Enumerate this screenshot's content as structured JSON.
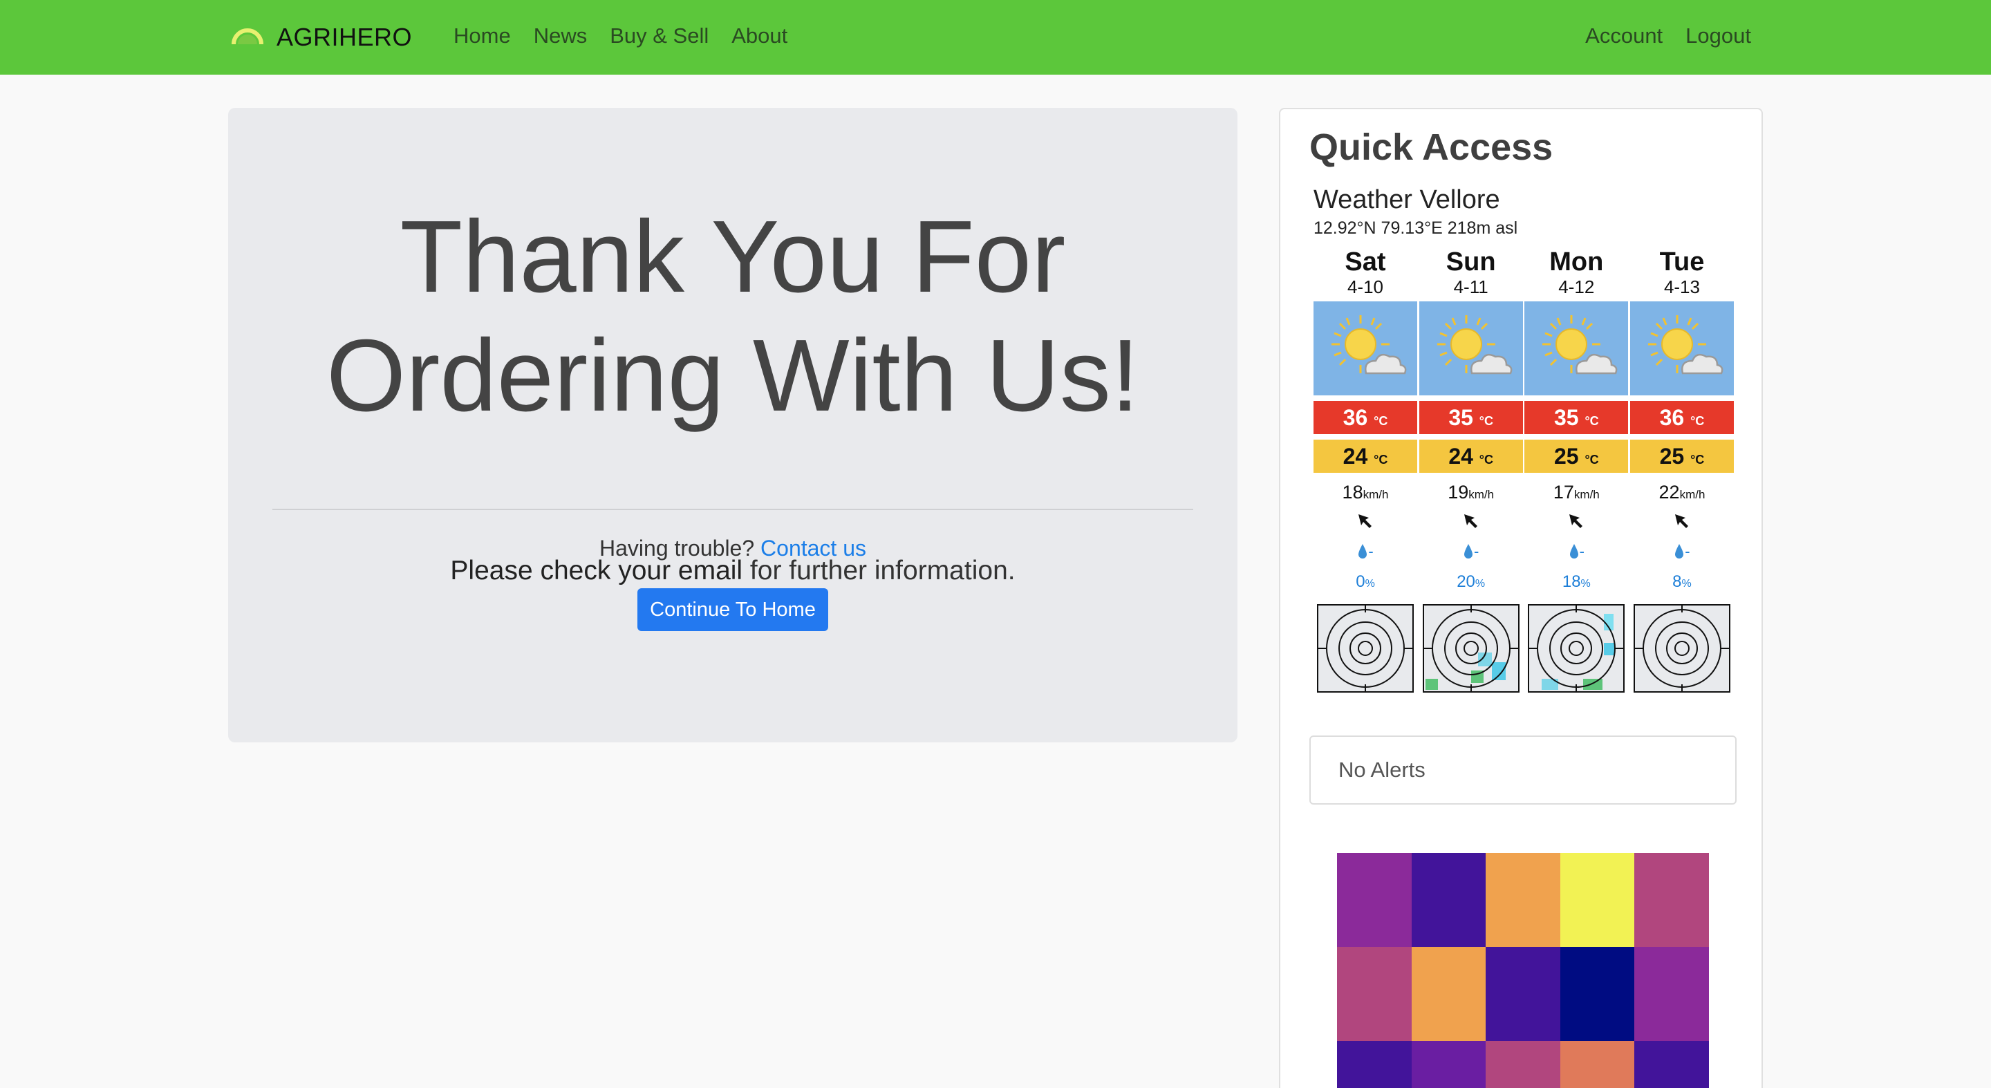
{
  "navbar": {
    "brand": "AGRIHERO",
    "links": [
      "Home",
      "News",
      "Buy & Sell",
      "About"
    ],
    "right_links": [
      "Account",
      "Logout"
    ],
    "bg_color": "#5cc73b"
  },
  "main": {
    "heading_line1": "Thank You For",
    "heading_line2": "Ordering With Us!",
    "lead_bold": "Please check your email",
    "lead_rest": " for further information.",
    "trouble_text": "Having trouble? ",
    "contact_link": "Contact us",
    "continue_button": "Continue To Home"
  },
  "sidebar": {
    "title": "Quick Access",
    "weather": {
      "title": "Weather Vellore",
      "coords": "12.92°N 79.13°E 218m asl",
      "days": [
        {
          "day": "Sat",
          "date": "4-10",
          "max": "36",
          "min": "24",
          "wind": "18",
          "rain": "-",
          "prob": "0"
        },
        {
          "day": "Sun",
          "date": "4-11",
          "max": "35",
          "min": "24",
          "wind": "19",
          "rain": "-",
          "prob": "20"
        },
        {
          "day": "Mon",
          "date": "4-12",
          "max": "35",
          "min": "25",
          "wind": "17",
          "rain": "-",
          "prob": "18"
        },
        {
          "day": "Tue",
          "date": "4-13",
          "max": "36",
          "min": "25",
          "wind": "22",
          "rain": "-",
          "prob": "8"
        }
      ],
      "temp_unit": "°C",
      "wind_unit": "km/h",
      "prob_unit": "%"
    },
    "alerts": "No Alerts",
    "heatmap_colors": [
      "#8b2a9a",
      "#42149a",
      "#f0a24e",
      "#f2f254",
      "#b1467e",
      "#b1467e",
      "#f0a24e",
      "#42149a",
      "#000c82",
      "#8b2a9a",
      "#42149a",
      "#6a1ea2",
      "#b1467e",
      "#e07a5a",
      "#42149a"
    ]
  }
}
